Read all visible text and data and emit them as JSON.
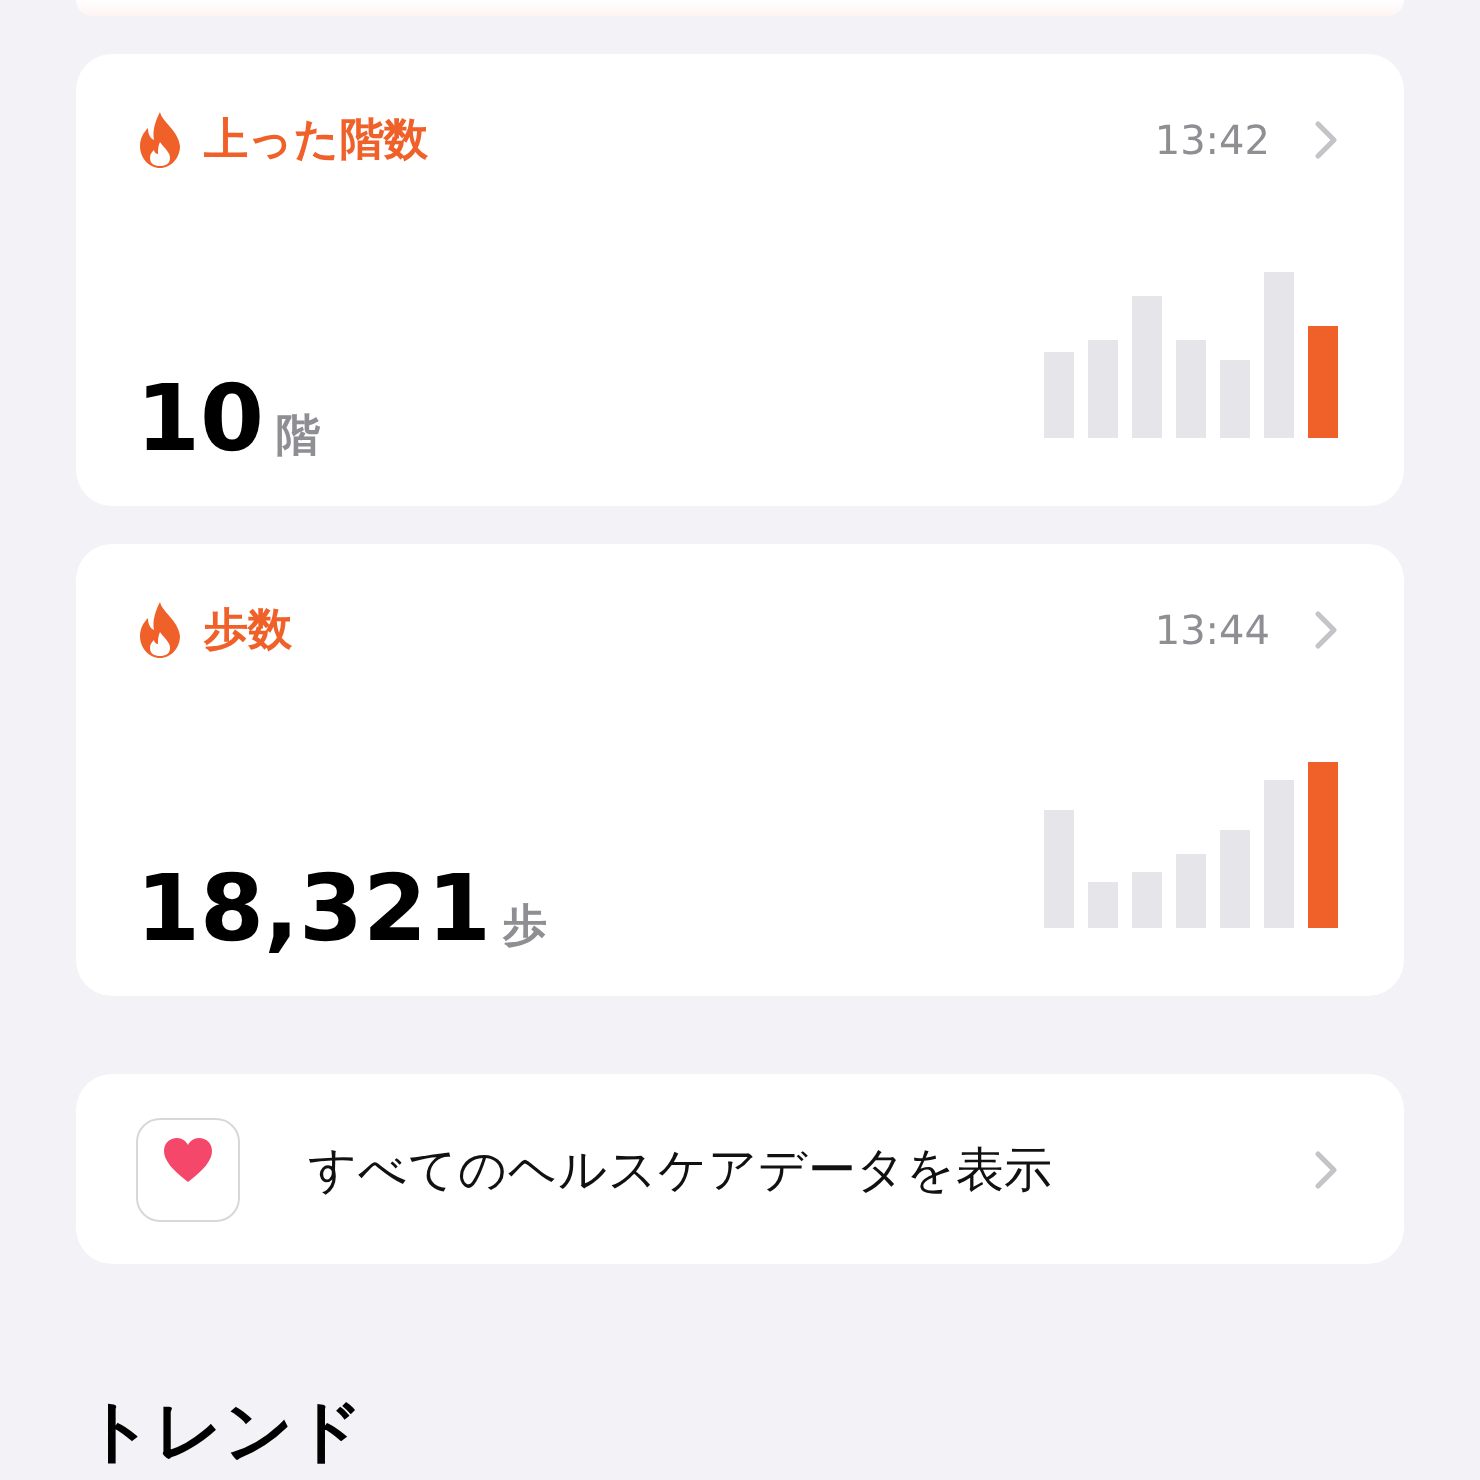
{
  "cards": [
    {
      "title": "上った階数",
      "time": "13:42",
      "value": "10",
      "unit": "階"
    },
    {
      "title": "歩数",
      "time": "13:44",
      "value": "18,321",
      "unit": "歩"
    }
  ],
  "link": {
    "label": "すべてのヘルスケアデータを表示"
  },
  "section": {
    "title": "トレンド"
  }
}
